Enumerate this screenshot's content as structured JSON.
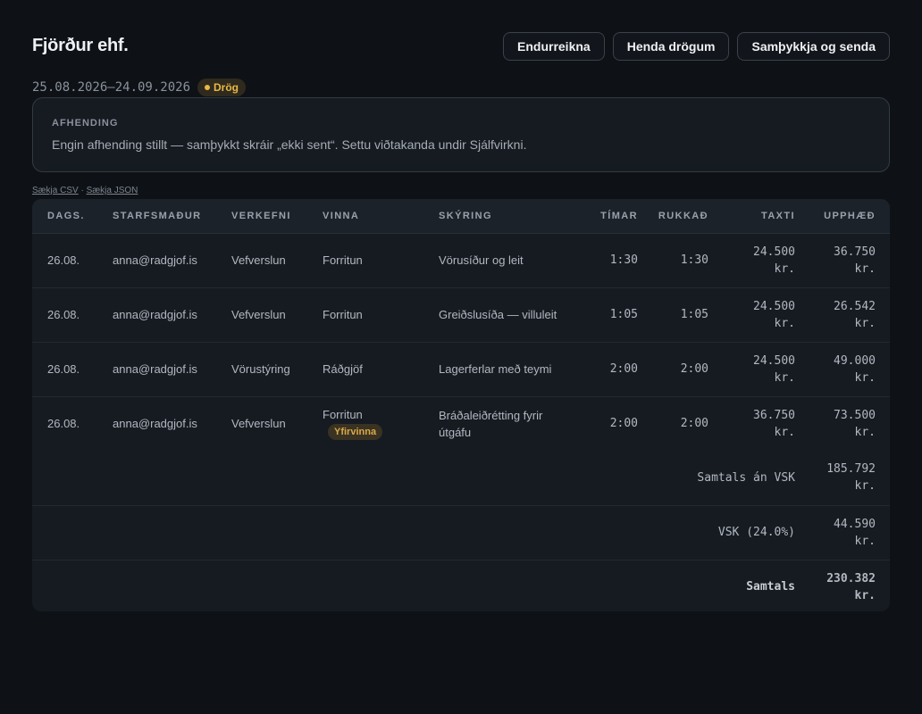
{
  "header": {
    "company": "Fjörður ehf.",
    "buttons": {
      "recalculate": "Endurreikna",
      "discard_draft": "Henda drögum",
      "approve_send": "Samþykkja og senda"
    }
  },
  "period": "25.08.2026–24.09.2026",
  "status_badge": "Drög",
  "delivery": {
    "title": "AFHENDING",
    "text": "Engin afhending stillt — samþykkt skráir „ekki sent“. Settu viðtakanda undir Sjálfvirkni."
  },
  "downloads": {
    "csv": "Sækja CSV",
    "separator": "·",
    "json": "Sækja JSON"
  },
  "table": {
    "columns": [
      "DAGS.",
      "STARFSMAÐUR",
      "VERKEFNI",
      "VINNA",
      "SKÝRING",
      "TÍMAR",
      "RUKKAÐ",
      "TAXTI",
      "UPPHÆÐ"
    ],
    "rows": [
      {
        "date": "26.08.",
        "employee": "anna@radgjof.is",
        "project": "Vefverslun",
        "work": "Forritun",
        "tag": "",
        "description": "Vörusíður og leit",
        "hours": "1:30",
        "billed": "1:30",
        "rate": "24.500",
        "rate_unit": "kr.",
        "amount": "36.750",
        "amount_unit": "kr."
      },
      {
        "date": "26.08.",
        "employee": "anna@radgjof.is",
        "project": "Vefverslun",
        "work": "Forritun",
        "tag": "",
        "description": "Greiðslusíða — villuleit",
        "hours": "1:05",
        "billed": "1:05",
        "rate": "24.500",
        "rate_unit": "kr.",
        "amount": "26.542",
        "amount_unit": "kr."
      },
      {
        "date": "26.08.",
        "employee": "anna@radgjof.is",
        "project": "Vörustýring",
        "work": "Ráðgjöf",
        "tag": "",
        "description": "Lagerferlar með teymi",
        "hours": "2:00",
        "billed": "2:00",
        "rate": "24.500",
        "rate_unit": "kr.",
        "amount": "49.000",
        "amount_unit": "kr."
      },
      {
        "date": "26.08.",
        "employee": "anna@radgjof.is",
        "project": "Vefverslun",
        "work": "Forritun",
        "tag": "Yfirvinna",
        "description": "Bráðaleiðrétting fyrir útgáfu",
        "hours": "2:00",
        "billed": "2:00",
        "rate": "36.750",
        "rate_unit": "kr.",
        "amount": "73.500",
        "amount_unit": "kr."
      }
    ],
    "summary": {
      "subtotal_label": "Samtals án VSK",
      "subtotal_value": "185.792",
      "vat_label": "VSK (24.0%)",
      "vat_value": "44.590",
      "total_label": "Samtals",
      "total_value": "230.382",
      "unit": "kr."
    }
  },
  "colors": {
    "background": "#0e1217",
    "panel": "#161b22",
    "accent_total": "#4fc27a",
    "draft_badge": "#e8b846"
  }
}
